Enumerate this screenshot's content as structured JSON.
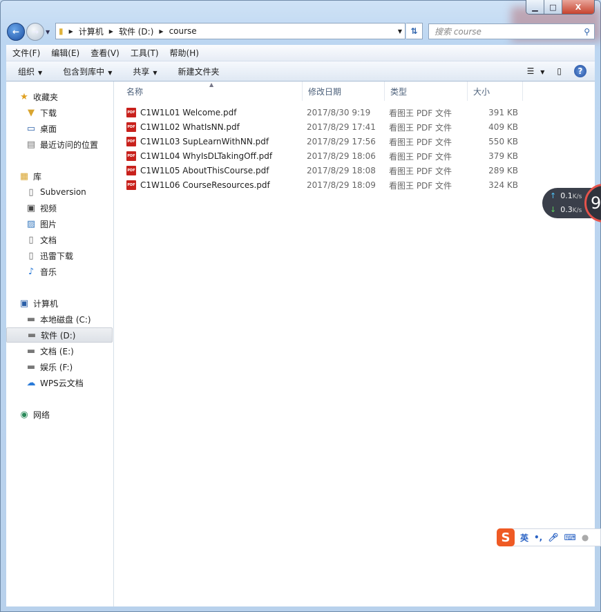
{
  "window": {
    "minimize": "▁",
    "maximize": "□",
    "close": "X"
  },
  "address": {
    "path": [
      "计算机",
      "软件 (D:)",
      "course"
    ]
  },
  "search": {
    "placeholder": "搜索 course"
  },
  "menu": [
    "文件(F)",
    "编辑(E)",
    "查看(V)",
    "工具(T)",
    "帮助(H)"
  ],
  "toolbar": {
    "organize": "组织",
    "include": "包含到库中",
    "share": "共享",
    "new_folder": "新建文件夹"
  },
  "sidebar": [
    {
      "label": "收藏夹",
      "icon": "star-icon",
      "group": true
    },
    {
      "label": "下载",
      "icon": "download-folder-icon"
    },
    {
      "label": "桌面",
      "icon": "desktop-icon"
    },
    {
      "label": "最近访问的位置",
      "icon": "recent-icon"
    },
    {
      "label": "库",
      "icon": "library-icon",
      "group": true
    },
    {
      "label": "Subversion",
      "icon": "document-icon"
    },
    {
      "label": "视频",
      "icon": "video-icon"
    },
    {
      "label": "图片",
      "icon": "picture-icon"
    },
    {
      "label": "文档",
      "icon": "document-icon"
    },
    {
      "label": "迅雷下载",
      "icon": "document-icon"
    },
    {
      "label": "音乐",
      "icon": "music-icon"
    },
    {
      "label": "计算机",
      "icon": "computer-icon",
      "group": true
    },
    {
      "label": "本地磁盘 (C:)",
      "icon": "drive-icon"
    },
    {
      "label": "软件 (D:)",
      "icon": "drive-icon",
      "selected": true
    },
    {
      "label": "文档 (E:)",
      "icon": "drive-icon"
    },
    {
      "label": "娱乐 (F:)",
      "icon": "drive-icon"
    },
    {
      "label": "WPS云文档",
      "icon": "cloud-icon"
    },
    {
      "label": "网络",
      "icon": "network-icon",
      "group": true
    }
  ],
  "columns": [
    "名称",
    "修改日期",
    "类型",
    "大小"
  ],
  "files": [
    {
      "name": "C1W1L01 Welcome.pdf",
      "date": "2017/8/30 9:19",
      "type": "看图王 PDF 文件",
      "size": "391 KB"
    },
    {
      "name": "C1W1L02 WhatIsNN.pdf",
      "date": "2017/8/29 17:41",
      "type": "看图王 PDF 文件",
      "size": "409 KB"
    },
    {
      "name": "C1W1L03 SupLearnWithNN.pdf",
      "date": "2017/8/29 17:56",
      "type": "看图王 PDF 文件",
      "size": "550 KB"
    },
    {
      "name": "C1W1L04 WhyIsDLTakingOff.pdf",
      "date": "2017/8/29 18:06",
      "type": "看图王 PDF 文件",
      "size": "379 KB"
    },
    {
      "name": "C1W1L05 AboutThisCourse.pdf",
      "date": "2017/8/29 18:08",
      "type": "看图王 PDF 文件",
      "size": "289 KB"
    },
    {
      "name": "C1W1L06 CourseResources.pdf",
      "date": "2017/8/29 18:09",
      "type": "看图王 PDF 文件",
      "size": "324 KB"
    }
  ],
  "net_widget": {
    "up": "0.1",
    "down": "0.3",
    "unit": "K/s",
    "gauge": "9"
  },
  "ime": {
    "logo": "S",
    "lang": "英",
    "punct": "•,"
  },
  "pdf_icon_text": "PDF"
}
